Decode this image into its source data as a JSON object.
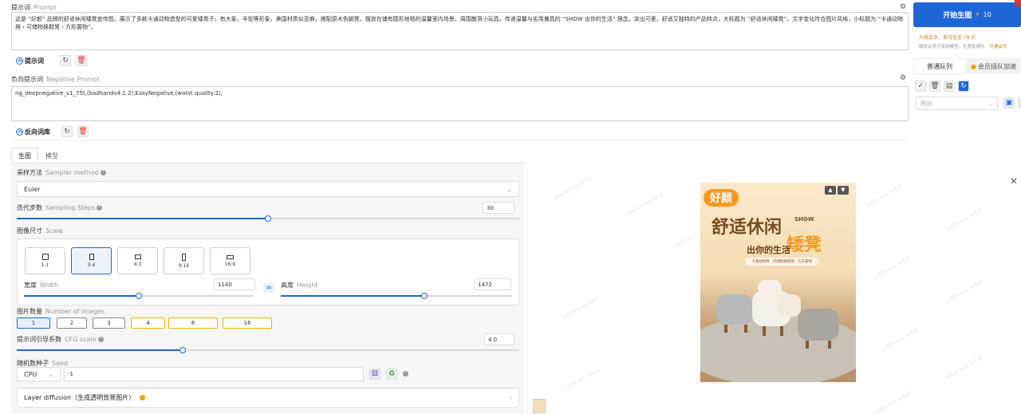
{
  "prompt": {
    "label": "提示词",
    "sublabel": "Prompt",
    "text": "这是 “好颜” 品牌的舒适休闲矮凳宣传图，展示了多款卡通动物造型的可爱矮凳子，有大象、羊驼等形象，美国材质似亚麻，搭配原木色脚凳，摆放在铺有圆形地毯的温馨室内场景，周围散落小玩具，传递温馨与实用兼具的 “SHOW 出你的生活” 理念，突出可爱、舒适又独特的产品特点，大标题为 “舒适休闲矮凳”，文字变化符合图片风格，小标题为 “卡通动物椅・可储物换鞋凳・方形置物”。",
    "toggle_label": "提示词"
  },
  "negative": {
    "label": "负向提示词",
    "sublabel": "Negative Prompt",
    "text": "ng_deepnegative_v1_75t,(badhandv4:1.2),EasyNegative,(worst quality:2),",
    "toggle_label": "反向词库"
  },
  "tabs": [
    "生图",
    "模型"
  ],
  "sampler": {
    "label": "采样方法",
    "sublabel": "Sampler method",
    "value": "Euler"
  },
  "steps": {
    "label": "迭代步数",
    "sublabel": "Sampling Steps",
    "value": "30",
    "fraction": 0.5
  },
  "scale": {
    "label": "图像尺寸",
    "sublabel": "Scale",
    "ratios": [
      "1:1",
      "3:4",
      "4:3",
      "9:16",
      "16:9"
    ],
    "selected": "3:4",
    "width_label": "宽度",
    "width_sub": "Width",
    "width_value": "1140",
    "width_fraction": 0.5,
    "height_label": "高度",
    "height_sub": "Height",
    "height_value": "1472",
    "height_fraction": 0.62
  },
  "images": {
    "label": "图片数量",
    "sublabel": "Number of images",
    "options": [
      "1",
      "2",
      "3",
      "4",
      "8",
      "16"
    ],
    "selected": "1"
  },
  "cfg": {
    "label": "提示词引导系数",
    "sublabel": "CFG scale",
    "value": "4.0",
    "fraction": 0.33
  },
  "seed": {
    "label": "随机数种子",
    "sublabel": "Seed",
    "device": "CPU",
    "value": "-1"
  },
  "layer": {
    "label": "Layer diffusion（生成透明背景图片）"
  },
  "generate": {
    "label": "开始生图",
    "cost": "10",
    "promo1": "升级会员，首月低至 78 折",
    "promo2": "解锁会员可享用模型，生图免排队",
    "promo_link": "开通会员"
  },
  "queue": {
    "tab1": "普通队列",
    "tab2": "会员插队加速"
  },
  "preset_placeholder": "预设",
  "poster": {
    "brand": "好颜",
    "title_a": "舒适休闲",
    "title_b": "矮凳",
    "show": "SHOW",
    "tagline": "出你的生活",
    "sub": "卡通动物椅 · 可储物换鞋凳 · 方形置物"
  },
  "watermark": "内容由Liblib AI生成",
  "colors": {
    "accent": "#1e66d6",
    "gold": "#f0b400",
    "danger": "#e03030",
    "promo": "#c08a2c"
  }
}
